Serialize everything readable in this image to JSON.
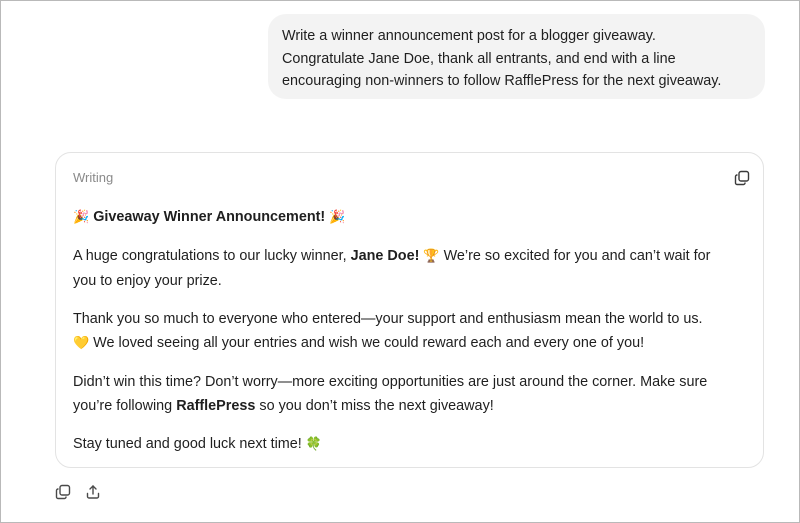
{
  "user_message": {
    "lines": [
      "Write a winner announcement post for a blogger giveaway.",
      "Congratulate Jane Doe, thank all entrants, and end with a line",
      "encouraging non-winners to follow RafflePress for the next giveaway."
    ]
  },
  "response": {
    "label": "Writing",
    "title": {
      "emoji_left": "🎉",
      "text": "Giveaway Winner Announcement!",
      "emoji_right": "🎉"
    },
    "p1": {
      "line1_pre": "A huge congratulations to our lucky winner, ",
      "winner": "Jane Doe",
      "line1_bang": "!",
      "trophy": "🏆",
      "line1_post": " We’re so excited for you and can’t wait for",
      "line2": "you to enjoy your prize."
    },
    "p2": {
      "line1": "Thank you so much to everyone who entered—your support and enthusiasm mean the world to us.",
      "heart": "💛",
      "line2": " We loved seeing all your entries and wish we could reward each and every one of you!"
    },
    "p3": {
      "line1": "Didn’t win this time? Don’t worry—more exciting opportunities are just around the corner. Make sure",
      "line2_pre": "you’re following ",
      "brand": "RafflePress",
      "line2_post": " so you don’t miss the next giveaway!"
    },
    "p4": {
      "text": "Stay tuned and good luck next time! ",
      "clover": "🍀"
    }
  },
  "icons": {
    "copy": "copy-icon",
    "share": "share-icon"
  },
  "colors": {
    "bubble_bg": "#f3f3f3",
    "label": "#8a8a8a",
    "text": "#1f1f1f",
    "border": "#e3e3e3"
  }
}
